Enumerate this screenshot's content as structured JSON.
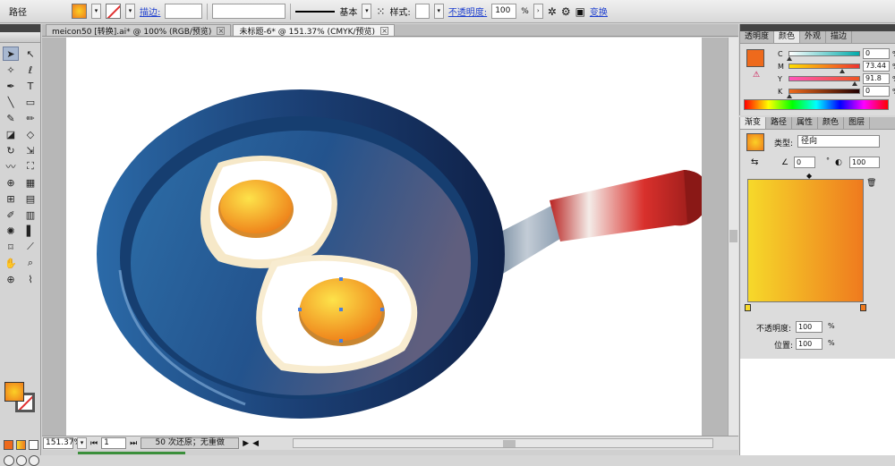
{
  "control_bar": {
    "path_label": "路径",
    "stroke_link": "描边:",
    "stroke_profile": "基本",
    "style_label": "样式:",
    "opacity_link": "不透明度:",
    "opacity_value": "100",
    "opacity_unit": "%",
    "transform_link": "变换"
  },
  "tabs": [
    {
      "label": "meicon50 [转换].ai* @ 100% (RGB/预览)"
    },
    {
      "label": "未标题-6* @ 151.37% (CMYK/预览)"
    }
  ],
  "status": {
    "zoom": "151.37%",
    "artboard": "1",
    "info": "50 次还原；无重做"
  },
  "color_panel": {
    "tabs": [
      "透明度",
      "颜色",
      "外观",
      "描边"
    ],
    "channels": [
      {
        "name": "C",
        "value": "0",
        "unit": "%"
      },
      {
        "name": "M",
        "value": "73.44",
        "unit": "%"
      },
      {
        "name": "Y",
        "value": "91.8",
        "unit": "%"
      },
      {
        "name": "K",
        "value": "0",
        "unit": "%"
      }
    ]
  },
  "gradient_panel": {
    "tabs": [
      "渐变",
      "路径",
      "属性",
      "颜色",
      "图层"
    ],
    "type_label": "类型:",
    "type_value": "径向",
    "angle": "0",
    "angle_unit": "°",
    "aspect": "100",
    "opacity_label": "不透明度:",
    "opacity_value": "100",
    "opacity_unit": "%",
    "location_label": "位置:",
    "location_value": "100",
    "location_unit": "%",
    "start_color": "#f6d92a",
    "end_color": "#ef7a1e"
  },
  "colors": {
    "fill_orange": "#ee6a1c",
    "pan_blue": "#1d4f86",
    "handle_red": "#c82a26"
  }
}
